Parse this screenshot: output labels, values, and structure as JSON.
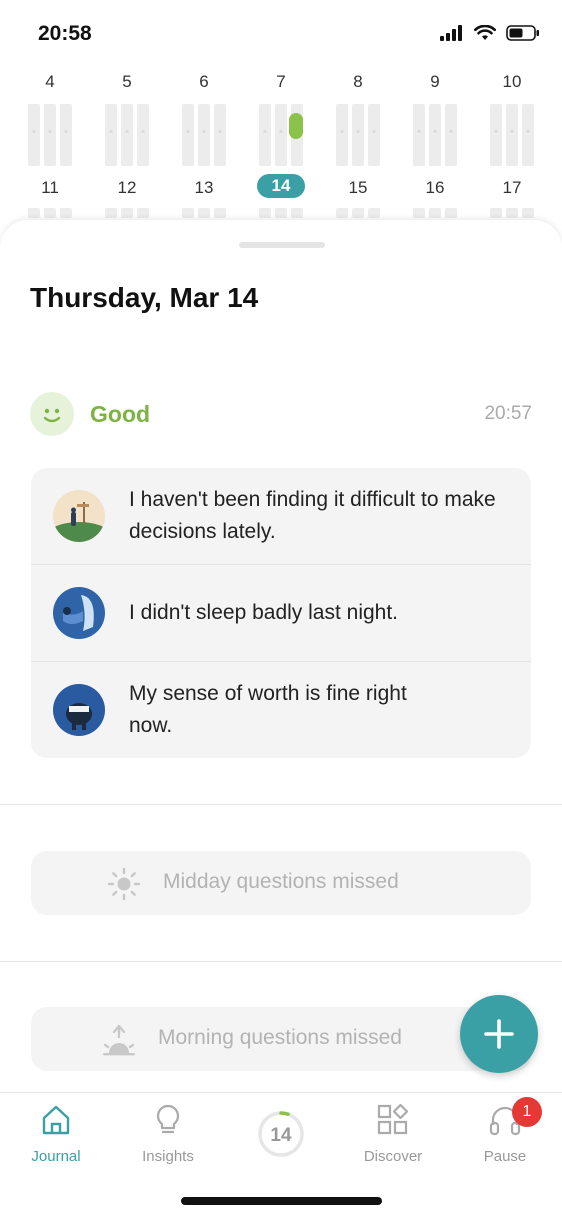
{
  "status_bar": {
    "time": "20:58"
  },
  "calendar": {
    "week1": [
      "4",
      "5",
      "6",
      "7",
      "8",
      "9",
      "10"
    ],
    "week2": [
      "11",
      "12",
      "13",
      "14",
      "15",
      "16",
      "17"
    ],
    "selected_day": "14"
  },
  "entry": {
    "date_title": "Thursday, Mar 14",
    "mood_label": "Good",
    "mood_time": "20:57",
    "items": [
      {
        "text": "I haven't been finding it difficult to make decisions lately."
      },
      {
        "text": "I didn't sleep badly last night."
      },
      {
        "text": "My sense of worth is fine right now."
      }
    ]
  },
  "missed": {
    "midday": "Midday questions missed",
    "morning": "Morning questions missed"
  },
  "fab": {
    "icon": "plus-icon"
  },
  "tabs": {
    "journal": "Journal",
    "insights": "Insights",
    "center_day": "14",
    "discover": "Discover",
    "pause": "Pause",
    "pause_badge": "1"
  },
  "colors": {
    "accent": "#3aa0a5",
    "good": "#7cb342",
    "badge": "#e53935"
  }
}
